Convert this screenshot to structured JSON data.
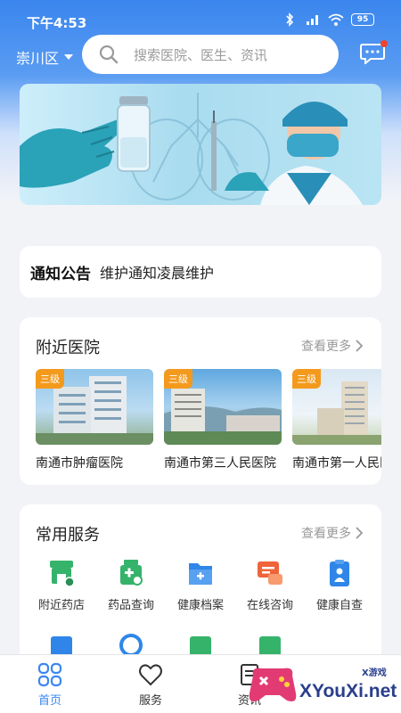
{
  "status_bar": {
    "time": "下午4:53",
    "battery": "95"
  },
  "header": {
    "location": "崇川区",
    "search_placeholder": "搜索医院、医生、资讯"
  },
  "notice": {
    "title": "通知公告",
    "text": "维护通知凌晨维护"
  },
  "nearby_hospitals": {
    "title": "附近医院",
    "more": "查看更多",
    "items": [
      {
        "badge": "三级",
        "name": "南通市肿瘤医院"
      },
      {
        "badge": "三级",
        "name": "南通市第三人民医院"
      },
      {
        "badge": "三级",
        "name": "南通市第一人民医院"
      }
    ]
  },
  "services": {
    "title": "常用服务",
    "more": "查看更多",
    "items": [
      {
        "label": "附近药店",
        "icon": "pharmacy-store-icon",
        "color": "#35b36b"
      },
      {
        "label": "药品查询",
        "icon": "medicine-bottle-icon",
        "color": "#35b36b"
      },
      {
        "label": "健康档案",
        "icon": "health-folder-icon",
        "color": "#2f86e8"
      },
      {
        "label": "在线咨询",
        "icon": "chat-consult-icon",
        "color": "#f0643a"
      },
      {
        "label": "健康自查",
        "icon": "clipboard-person-icon",
        "color": "#2f86e8"
      }
    ]
  },
  "tabbar": {
    "items": [
      {
        "label": "首页",
        "icon": "home-grid-icon",
        "active": true
      },
      {
        "label": "服务",
        "icon": "heart-icon",
        "active": false
      },
      {
        "label": "资讯",
        "icon": "news-icon",
        "active": false
      }
    ]
  },
  "watermark": {
    "text": "XYouXi.net",
    "sub": "X游戏"
  },
  "colors": {
    "accent": "#3a86ee",
    "badge": "#f39a1d"
  }
}
